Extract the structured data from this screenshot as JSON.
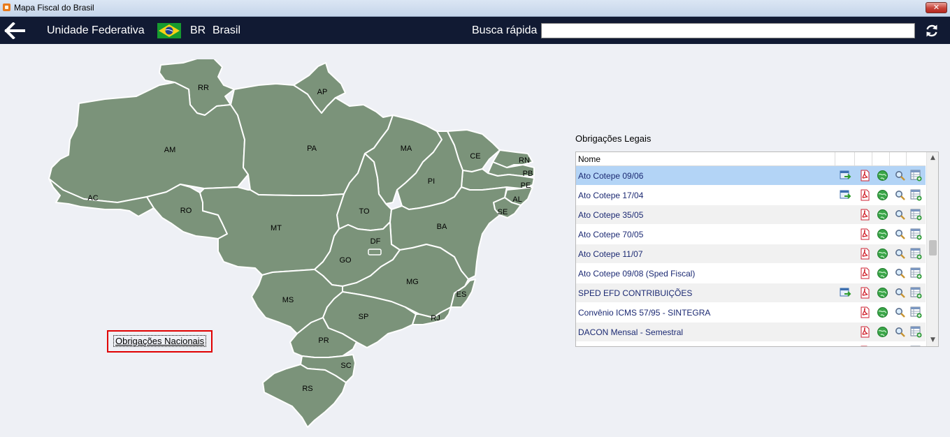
{
  "window": {
    "title": "Mapa Fiscal do Brasil",
    "close_symbol": "✕"
  },
  "toolbar": {
    "uf_label": "Unidade Federativa",
    "state_code": "BR",
    "state_name": "Brasil",
    "search_label": "Busca rápida",
    "search_value": "",
    "search_placeholder": ""
  },
  "map": {
    "states": [
      "RR",
      "AP",
      "AM",
      "PA",
      "MA",
      "CE",
      "RN",
      "PB",
      "PE",
      "AL",
      "SE",
      "PI",
      "AC",
      "RO",
      "TO",
      "MT",
      "BA",
      "DF",
      "GO",
      "MG",
      "ES",
      "MS",
      "SP",
      "RJ",
      "PR",
      "SC",
      "RS"
    ]
  },
  "national_link": "Obrigações Nacionais",
  "obligations": {
    "title": "Obrigações Legais",
    "header_name": "Nome",
    "rows": [
      {
        "name": "Ato Cotepe 09/06",
        "import_icon": true
      },
      {
        "name": "Ato Cotepe 17/04",
        "import_icon": true
      },
      {
        "name": "Ato Cotepe 35/05",
        "import_icon": false
      },
      {
        "name": "Ato Cotepe 70/05",
        "import_icon": false
      },
      {
        "name": "Ato Cotepe 11/07",
        "import_icon": false
      },
      {
        "name": "Ato Cotepe 09/08 (Sped Fiscal)",
        "import_icon": false
      },
      {
        "name": "SPED EFD CONTRIBUIÇÕES",
        "import_icon": true
      },
      {
        "name": "Convênio ICMS 57/95 - SINTEGRA",
        "import_icon": false
      },
      {
        "name": "DACON Mensal - Semestral",
        "import_icon": false
      }
    ],
    "selected_index": 0
  },
  "colors": {
    "toolbar_bg": "#111a33",
    "map_fill": "#7b937a",
    "selection": "#b3d4f6",
    "highlight_border": "#e00000"
  }
}
